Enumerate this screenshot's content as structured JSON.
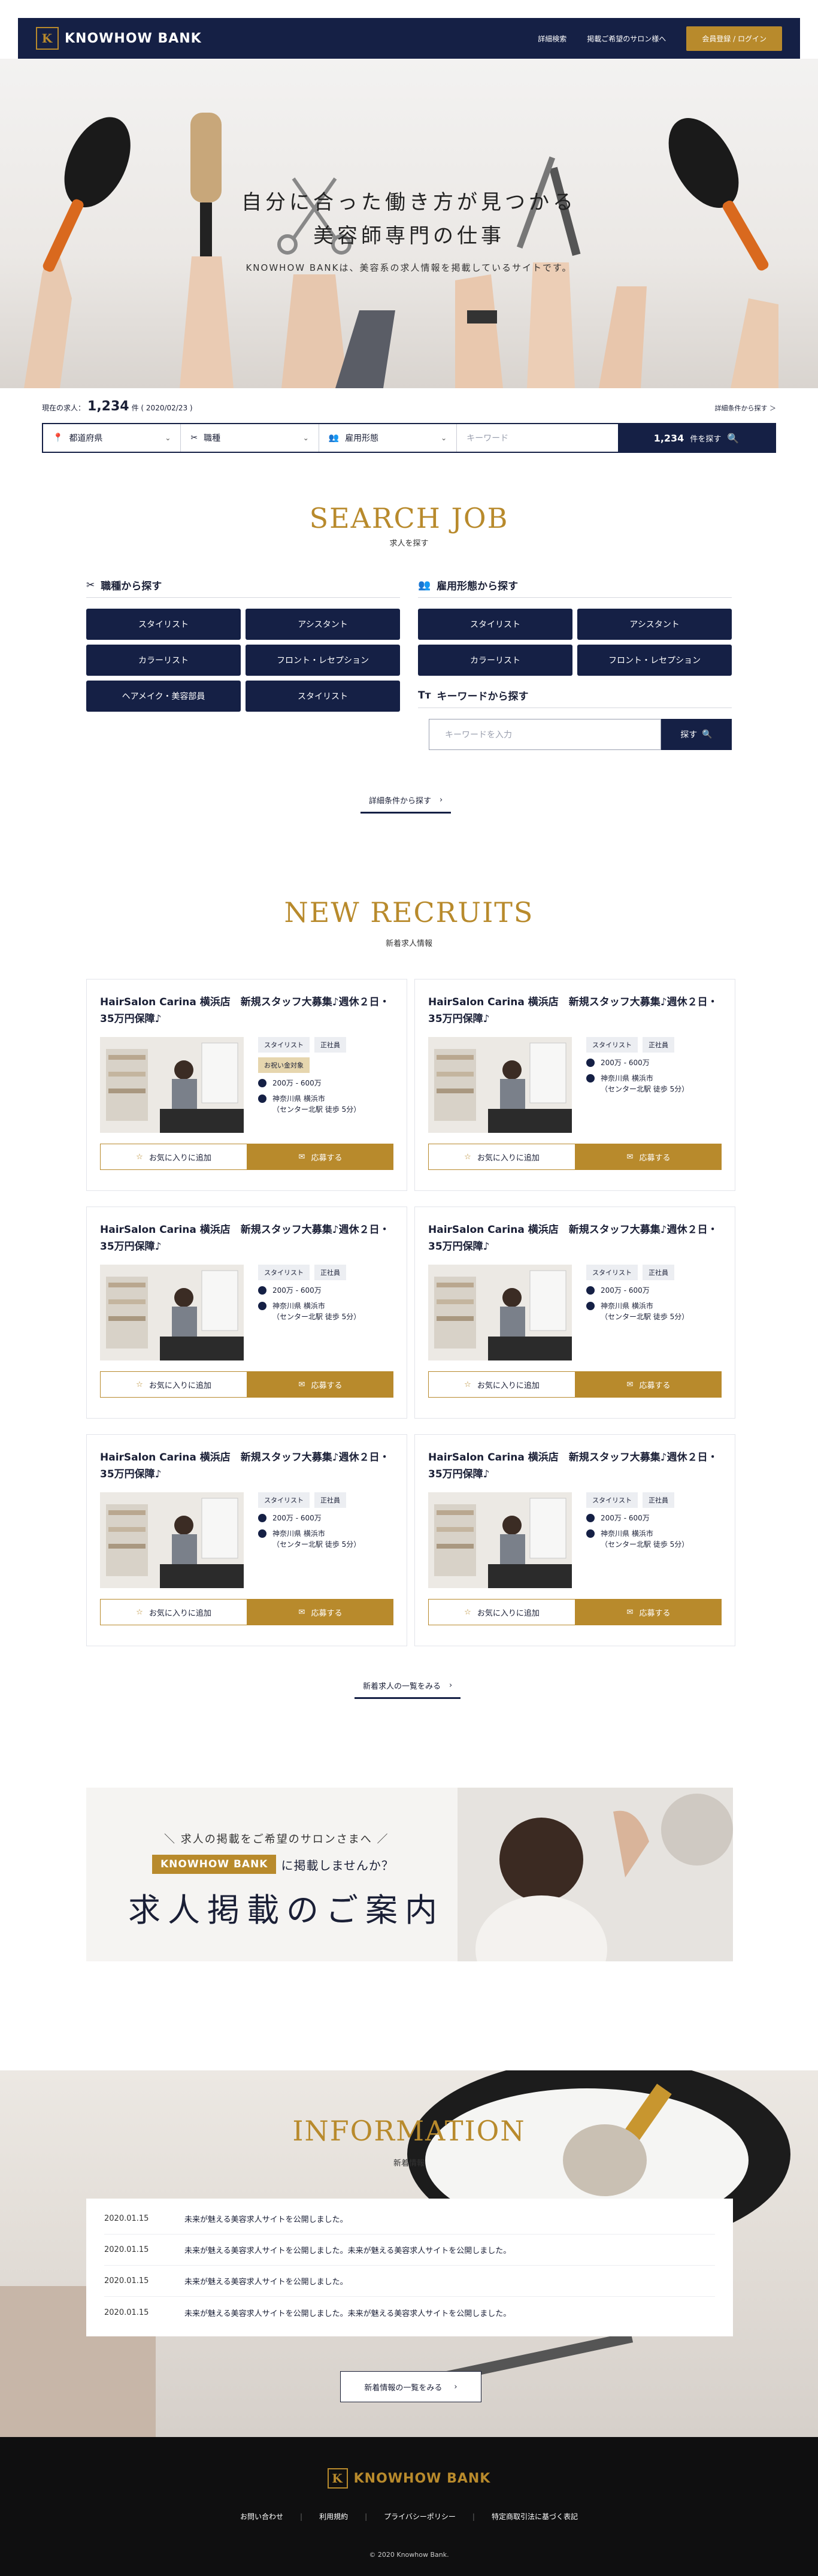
{
  "header": {
    "logo_mark": "K",
    "logo_text": "KNOWHOW BANK",
    "nav": [
      "詳細検索",
      "掲載ご希望のサロン様へ"
    ],
    "login": "会員登録 / ログイン"
  },
  "hero": {
    "title_l1": "自分に合った働き方が見つかる",
    "title_l2": "美容師専門の仕事",
    "subtitle": "KNOWHOW BANKは、美容系の求人情報を掲載しているサイトです。"
  },
  "search_bar": {
    "count_prefix": "現在の求人：",
    "count": "1,234",
    "count_suffix": "件 ( 2020/02/23 )",
    "detail_link": "詳細条件から探す ＞",
    "prefecture": "都道府県",
    "occupation": "職種",
    "employment": "雇用形態",
    "keyword_placeholder": "キーワード",
    "button_count": "1,234",
    "button_suffix": "件を探す"
  },
  "search_job": {
    "title": "SEARCH JOB",
    "subtitle": "求人を探す",
    "occupation_heading": "職種から探す",
    "occupation_items": [
      "スタイリスト",
      "アシスタント",
      "カラーリスト",
      "フロント・レセプション",
      "ヘアメイク・美容部員",
      "スタイリスト"
    ],
    "employment_heading": "雇用形態から探す",
    "employment_items": [
      "スタイリスト",
      "アシスタント",
      "カラーリスト",
      "フロント・レセプション"
    ],
    "keyword_heading": "キーワードから探す",
    "keyword_placeholder": "キーワードを入力",
    "keyword_button": "探す",
    "detail_link": "詳細条件から探す"
  },
  "new_recruits": {
    "title": "NEW RECRUITS",
    "subtitle": "新着求人情報",
    "cards": [
      {
        "title": "HairSalon Carina 横浜店　新規スタッフ大募集♪週休２日・35万円保障♪",
        "tags": [
          "スタイリスト",
          "正社員",
          "お祝い金対象"
        ],
        "salary": "200万 - 600万",
        "location": "神奈川県 横浜市",
        "station": "（センター北駅 徒歩 5分）"
      },
      {
        "title": "HairSalon Carina 横浜店　新規スタッフ大募集♪週休２日・35万円保障♪",
        "tags": [
          "スタイリスト",
          "正社員"
        ],
        "salary": "200万 - 600万",
        "location": "神奈川県 横浜市",
        "station": "（センター北駅 徒歩 5分）"
      },
      {
        "title": "HairSalon Carina 横浜店　新規スタッフ大募集♪週休２日・35万円保障♪",
        "tags": [
          "スタイリスト",
          "正社員"
        ],
        "salary": "200万 - 600万",
        "location": "神奈川県 横浜市",
        "station": "（センター北駅 徒歩 5分）"
      },
      {
        "title": "HairSalon Carina 横浜店　新規スタッフ大募集♪週休２日・35万円保障♪",
        "tags": [
          "スタイリスト",
          "正社員"
        ],
        "salary": "200万 - 600万",
        "location": "神奈川県 横浜市",
        "station": "（センター北駅 徒歩 5分）"
      },
      {
        "title": "HairSalon Carina 横浜店　新規スタッフ大募集♪週休２日・35万円保障♪",
        "tags": [
          "スタイリスト",
          "正社員"
        ],
        "salary": "200万 - 600万",
        "location": "神奈川県 横浜市",
        "station": "（センター北駅 徒歩 5分）"
      },
      {
        "title": "HairSalon Carina 横浜店　新規スタッフ大募集♪週休２日・35万円保障♪",
        "tags": [
          "スタイリスト",
          "正社員"
        ],
        "salary": "200万 - 600万",
        "location": "神奈川県 横浜市",
        "station": "（センター北駅 徒歩 5分）"
      }
    ],
    "fav_label": "お気に入りに追加",
    "apply_label": "応募する",
    "list_link": "新着求人の一覧をみる"
  },
  "banner": {
    "line1": "＼ 求人の掲載をご希望のサロンさまへ ／",
    "badge": "KNOWHOW BANK",
    "line2": "に掲載しませんか？",
    "line3": "求人掲載のご案内"
  },
  "information": {
    "title": "INFORMATION",
    "subtitle": "新着情報",
    "items": [
      {
        "date": "2020.01.15",
        "text": "未来が魅える美容求人サイトを公開しました。"
      },
      {
        "date": "2020.01.15",
        "text": "未来が魅える美容求人サイトを公開しました。未来が魅える美容求人サイトを公開しました。"
      },
      {
        "date": "2020.01.15",
        "text": "未来が魅える美容求人サイトを公開しました。"
      },
      {
        "date": "2020.01.15",
        "text": "未来が魅える美容求人サイトを公開しました。未来が魅える美容求人サイトを公開しました。"
      }
    ],
    "list_link": "新着情報の一覧をみる"
  },
  "footer": {
    "logo_text": "KNOWHOW BANK",
    "links": [
      "お問い合わせ",
      "利用規約",
      "プライバシーポリシー",
      "特定商取引法に基づく表記"
    ],
    "copyright": "© 2020 Knowhow Bank."
  },
  "colors": {
    "navy": "#152045",
    "gold": "#b88a2c"
  }
}
